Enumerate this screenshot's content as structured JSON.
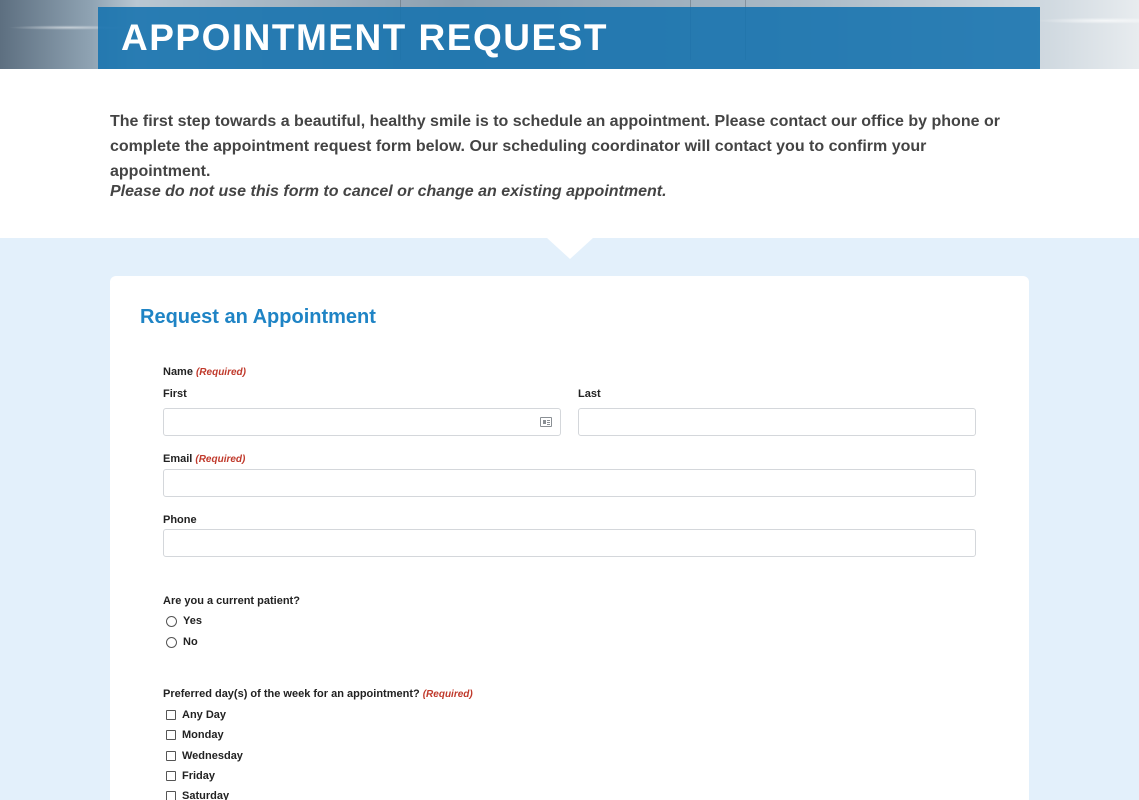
{
  "header": {
    "title": "APPOINTMENT REQUEST"
  },
  "intro": {
    "text": "The first step towards a beautiful, healthy smile is to schedule an appointment. Please contact our office by phone or complete the appointment request form below. Our scheduling coordinator will contact you to confirm your appointment.",
    "note": "Please do not use this form to cancel or change an existing appointment."
  },
  "form": {
    "title": "Request an Appointment",
    "required_tag": "(Required)",
    "name_label": "Name",
    "first_label": "First",
    "last_label": "Last",
    "email_label": "Email",
    "phone_label": "Phone",
    "patient_question": "Are you a current patient?",
    "patient_options": [
      "Yes",
      "No"
    ],
    "days_question": "Preferred day(s) of the week for an appointment?",
    "day_options": [
      "Any Day",
      "Monday",
      "Wednesday",
      "Friday",
      "Saturday"
    ]
  },
  "icons": {
    "contact_card": "contact-card-icon"
  },
  "colors": {
    "header_band": "#1572ae",
    "form_title": "#1f84c5",
    "required": "#c0392b",
    "section_bg": "#e3f0fb"
  }
}
